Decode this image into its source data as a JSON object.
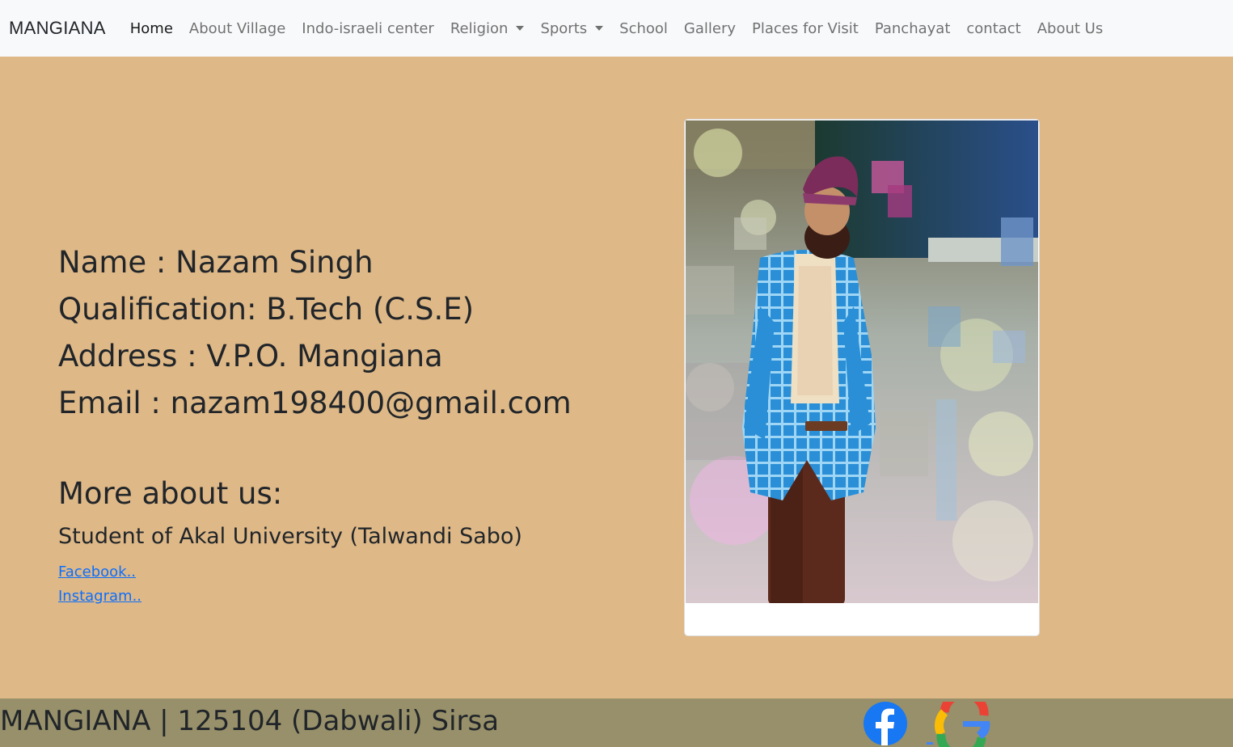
{
  "nav": {
    "brand": "MANGIANA",
    "items": [
      {
        "label": "Home",
        "active": true
      },
      {
        "label": "About Village"
      },
      {
        "label": "Indo-israeli center"
      },
      {
        "label": "Religion",
        "dropdown": true
      },
      {
        "label": "Sports",
        "dropdown": true
      },
      {
        "label": "School"
      },
      {
        "label": "Gallery"
      },
      {
        "label": "Places for Visit"
      },
      {
        "label": "Panchayat"
      },
      {
        "label": "contact"
      },
      {
        "label": "About Us"
      }
    ]
  },
  "profile": {
    "name_line": "Name : Nazam Singh",
    "qualification_line": "Qualification: B.Tech (C.S.E)",
    "address_line": "Address : V.P.O. Mangiana",
    "email_line": "Email : nazam198400@gmail.com"
  },
  "more": {
    "heading": "More about us:",
    "description": "Student of Akal University (Talwandi Sabo)",
    "facebook_link": "Facebook..",
    "instagram_link": "Instagram.."
  },
  "footer": {
    "text": "MANGIANA | 125104 (Dabwali) Sirsa"
  },
  "colors": {
    "page_bg": "#deb887",
    "navbar_bg": "#f8f9fa",
    "footer_bg": "#97906a",
    "link": "#0d6efd",
    "facebook": "#1877f2"
  },
  "icons": [
    "facebook-icon",
    "google-icon"
  ]
}
